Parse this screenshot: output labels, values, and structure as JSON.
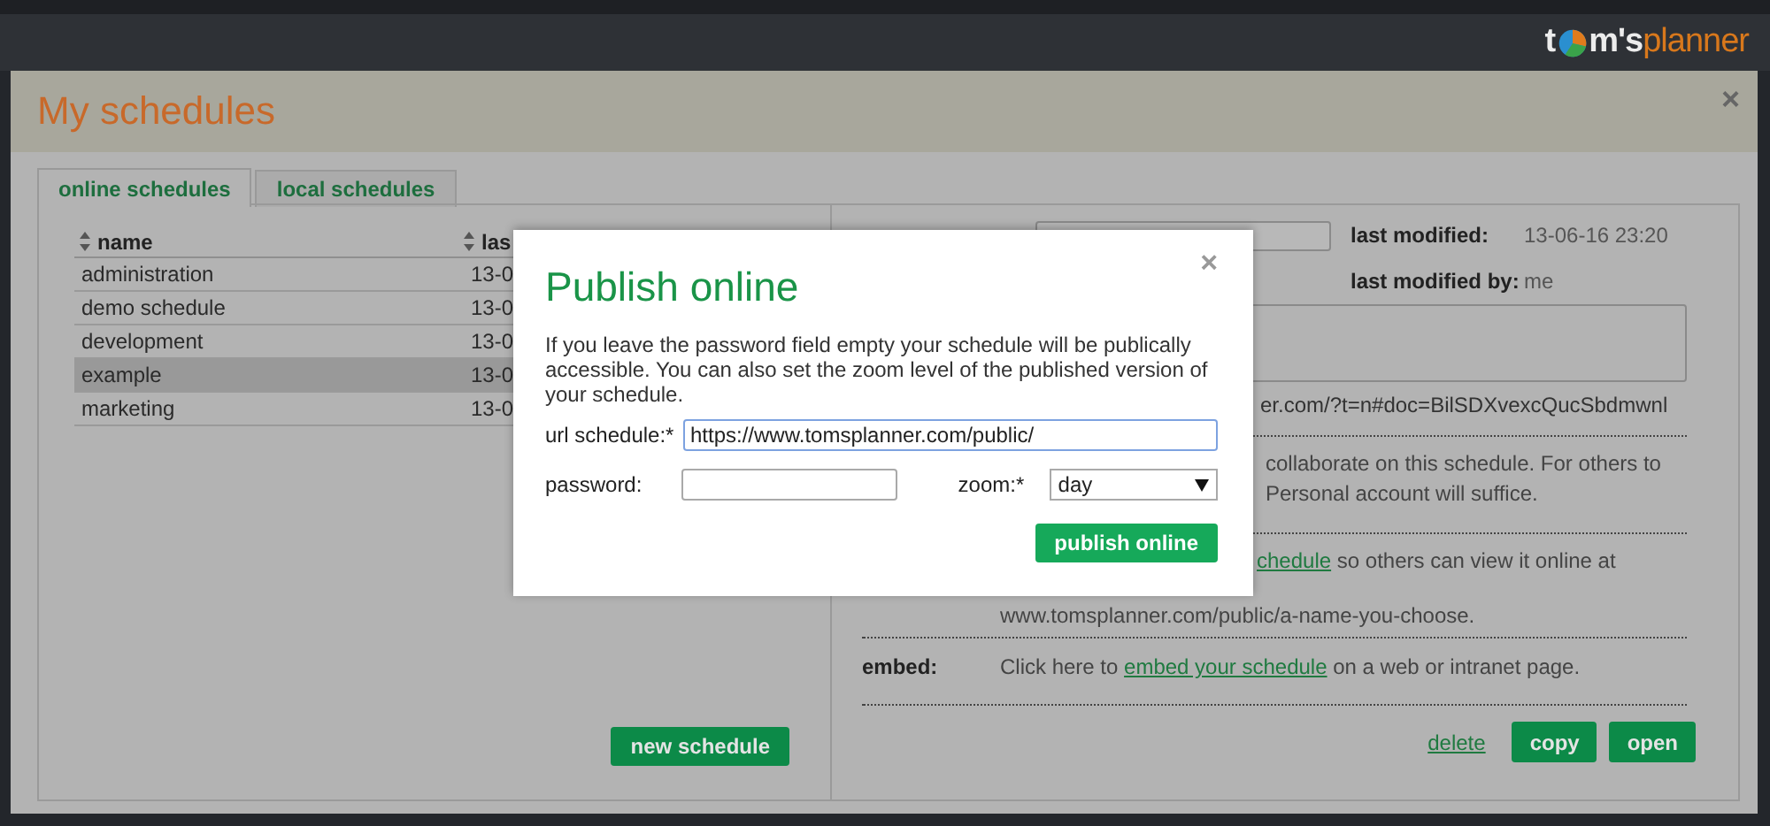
{
  "app_bar": {
    "logo": {
      "lead": "t",
      "trail": "m's",
      "accent": "planner"
    }
  },
  "modal": {
    "title": "My schedules",
    "close": "×",
    "tabs": [
      {
        "label": "online schedules",
        "selected": true
      },
      {
        "label": "local schedules",
        "selected": false
      }
    ],
    "table": {
      "columns": [
        "name",
        "las"
      ],
      "rows": [
        {
          "cells": [
            "administration",
            "13-0"
          ],
          "selected": false
        },
        {
          "cells": [
            "demo schedule",
            "13-0"
          ],
          "selected": false
        },
        {
          "cells": [
            "development",
            "13-0"
          ],
          "selected": false
        },
        {
          "cells": [
            "example",
            "13-0"
          ],
          "selected": true
        },
        {
          "cells": [
            "marketing",
            "13-0"
          ],
          "selected": false
        }
      ]
    },
    "new_button": "new schedule",
    "details": {
      "last_modified_label": "last modified:",
      "last_modified": "13-06-16 23:20",
      "last_modified_by_label": "last modified by:",
      "last_modified_by": "me",
      "url_fragment": "er.com/?t=n#doc=BilSDXvexcQucSbdmwnl",
      "share_lines": [
        "collaborate on this schedule. For others to",
        "Personal account will suffice."
      ],
      "publish_link": "chedule",
      "publish_rest": " so others can view it online at",
      "publish_line2": "www.tomsplanner.com/public/a-name-you-choose.",
      "embed_label": "embed:",
      "embed_before": "Click here to ",
      "embed_link": "embed your schedule",
      "embed_after": " on a web or intranet page.",
      "delete": "delete",
      "copy": "copy",
      "open": "open"
    }
  },
  "dialog": {
    "title": "Publish online",
    "close": "×",
    "intro": "If you leave the password field empty your schedule will be publically accessible. You can also set the zoom level of the published version of your schedule.",
    "url_label": "url schedule:*",
    "url_value": "https://www.tomsplanner.com/public/",
    "password_label": "password:",
    "zoom_label": "zoom:*",
    "zoom_value": "day",
    "submit": "publish online"
  }
}
